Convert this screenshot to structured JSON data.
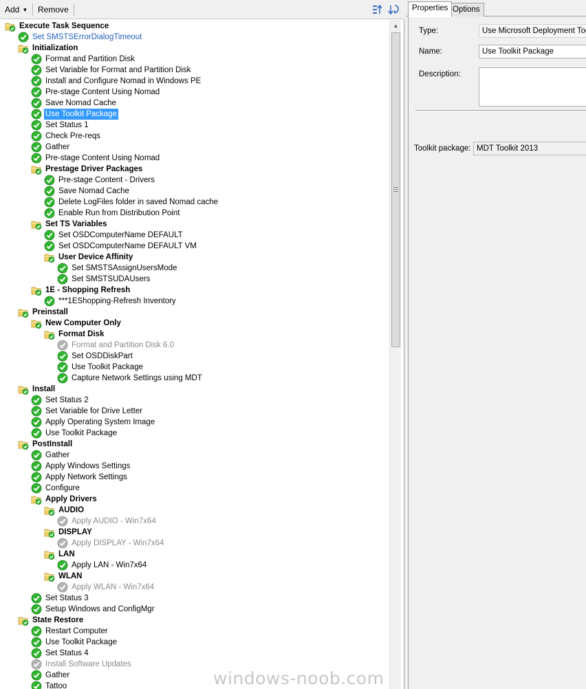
{
  "toolbar": {
    "add_label": "Add",
    "remove_label": "Remove"
  },
  "tree": [
    {
      "label": "Execute Task Sequence",
      "depth": 0,
      "kind": "group",
      "icon": "folder-check-icon"
    },
    {
      "label": "Set SMSTSErrorDialogTimeout",
      "depth": 1,
      "kind": "step",
      "icon": "green-check-icon",
      "style": "blue"
    },
    {
      "label": "Initialization",
      "depth": 1,
      "kind": "group",
      "icon": "folder-check-icon"
    },
    {
      "label": "Format and Partition Disk",
      "depth": 2,
      "kind": "step",
      "icon": "green-check-icon"
    },
    {
      "label": "Set Variable for Format and Partition Disk",
      "depth": 2,
      "kind": "step",
      "icon": "green-check-icon"
    },
    {
      "label": "Install and Configure Nomad in Windows PE",
      "depth": 2,
      "kind": "step",
      "icon": "green-check-icon"
    },
    {
      "label": "Pre-stage Content Using Nomad",
      "depth": 2,
      "kind": "step",
      "icon": "green-check-icon"
    },
    {
      "label": "Save Nomad Cache",
      "depth": 2,
      "kind": "step",
      "icon": "green-check-icon"
    },
    {
      "label": "Use Toolkit Package",
      "depth": 2,
      "kind": "step",
      "icon": "green-check-icon",
      "selected": true
    },
    {
      "label": "Set Status 1",
      "depth": 2,
      "kind": "step",
      "icon": "green-check-icon"
    },
    {
      "label": "Check Pre-reqs",
      "depth": 2,
      "kind": "step",
      "icon": "green-check-icon"
    },
    {
      "label": "Gather",
      "depth": 2,
      "kind": "step",
      "icon": "green-check-icon"
    },
    {
      "label": "Pre-stage Content Using Nomad",
      "depth": 2,
      "kind": "step",
      "icon": "green-check-icon"
    },
    {
      "label": "Prestage Driver Packages",
      "depth": 2,
      "kind": "group",
      "icon": "folder-check-icon"
    },
    {
      "label": "Pre-stage Content - Drivers",
      "depth": 3,
      "kind": "step",
      "icon": "green-check-icon"
    },
    {
      "label": "Save Nomad Cache",
      "depth": 3,
      "kind": "step",
      "icon": "green-check-icon"
    },
    {
      "label": "Delete LogFiles folder in saved Nomad cache",
      "depth": 3,
      "kind": "step",
      "icon": "green-check-icon"
    },
    {
      "label": "Enable Run from Distribution Point",
      "depth": 3,
      "kind": "step",
      "icon": "green-check-icon"
    },
    {
      "label": "Set TS Variables",
      "depth": 2,
      "kind": "group",
      "icon": "folder-check-icon"
    },
    {
      "label": "Set OSDComputerName DEFAULT",
      "depth": 3,
      "kind": "step",
      "icon": "green-check-icon"
    },
    {
      "label": "Set OSDComputerName DEFAULT VM",
      "depth": 3,
      "kind": "step",
      "icon": "green-check-icon"
    },
    {
      "label": "User Device Affinity",
      "depth": 3,
      "kind": "group",
      "icon": "folder-check-icon"
    },
    {
      "label": "Set SMSTSAssignUsersMode",
      "depth": 4,
      "kind": "step",
      "icon": "green-check-icon"
    },
    {
      "label": "Set SMSTSUDAUsers",
      "depth": 4,
      "kind": "step",
      "icon": "green-check-icon"
    },
    {
      "label": "1E - Shopping Refresh",
      "depth": 2,
      "kind": "group",
      "icon": "folder-check-icon"
    },
    {
      "label": "***1EShopping-Refresh Inventory",
      "depth": 3,
      "kind": "step",
      "icon": "green-check-icon"
    },
    {
      "label": "Preinstall",
      "depth": 1,
      "kind": "group",
      "icon": "folder-check-icon"
    },
    {
      "label": "New Computer Only",
      "depth": 2,
      "kind": "group",
      "icon": "folder-check-icon"
    },
    {
      "label": "Format Disk",
      "depth": 3,
      "kind": "group",
      "icon": "folder-check-icon"
    },
    {
      "label": "Format and Partition Disk 6.0",
      "depth": 4,
      "kind": "step",
      "icon": "grey-check-icon",
      "style": "disabled"
    },
    {
      "label": "Set OSDDiskPart",
      "depth": 4,
      "kind": "step",
      "icon": "green-check-icon"
    },
    {
      "label": "Use Toolkit Package",
      "depth": 4,
      "kind": "step",
      "icon": "green-check-icon"
    },
    {
      "label": "Capture Network Settings using MDT",
      "depth": 4,
      "kind": "step",
      "icon": "green-check-icon"
    },
    {
      "label": "Install",
      "depth": 1,
      "kind": "group",
      "icon": "folder-check-icon"
    },
    {
      "label": "Set Status 2",
      "depth": 2,
      "kind": "step",
      "icon": "green-check-icon"
    },
    {
      "label": "Set Variable for Drive Letter",
      "depth": 2,
      "kind": "step",
      "icon": "green-check-icon"
    },
    {
      "label": "Apply Operating System Image",
      "depth": 2,
      "kind": "step",
      "icon": "green-check-icon"
    },
    {
      "label": "Use Toolkit Package",
      "depth": 2,
      "kind": "step",
      "icon": "green-check-icon"
    },
    {
      "label": "PostInstall",
      "depth": 1,
      "kind": "group",
      "icon": "folder-check-icon"
    },
    {
      "label": "Gather",
      "depth": 2,
      "kind": "step",
      "icon": "green-check-icon"
    },
    {
      "label": "Apply Windows Settings",
      "depth": 2,
      "kind": "step",
      "icon": "green-check-icon"
    },
    {
      "label": "Apply Network Settings",
      "depth": 2,
      "kind": "step",
      "icon": "green-check-icon"
    },
    {
      "label": "Configure",
      "depth": 2,
      "kind": "step",
      "icon": "green-check-icon"
    },
    {
      "label": "Apply Drivers",
      "depth": 2,
      "kind": "group",
      "icon": "folder-check-icon"
    },
    {
      "label": "AUDIO",
      "depth": 3,
      "kind": "group",
      "icon": "folder-check-icon"
    },
    {
      "label": "Apply AUDIO - Win7x64",
      "depth": 4,
      "kind": "step",
      "icon": "grey-check-icon",
      "style": "disabled"
    },
    {
      "label": "DISPLAY",
      "depth": 3,
      "kind": "group",
      "icon": "folder-check-icon"
    },
    {
      "label": "Apply DISPLAY - Win7x64",
      "depth": 4,
      "kind": "step",
      "icon": "grey-check-icon",
      "style": "disabled"
    },
    {
      "label": "LAN",
      "depth": 3,
      "kind": "group",
      "icon": "folder-check-icon"
    },
    {
      "label": "Apply LAN - Win7x64",
      "depth": 4,
      "kind": "step",
      "icon": "green-check-icon"
    },
    {
      "label": "WLAN",
      "depth": 3,
      "kind": "group",
      "icon": "folder-check-icon"
    },
    {
      "label": "Apply WLAN - Win7x64",
      "depth": 4,
      "kind": "step",
      "icon": "grey-check-icon",
      "style": "disabled"
    },
    {
      "label": "Set Status 3",
      "depth": 2,
      "kind": "step",
      "icon": "green-check-icon"
    },
    {
      "label": "Setup Windows and ConfigMgr",
      "depth": 2,
      "kind": "step",
      "icon": "green-check-icon"
    },
    {
      "label": "State Restore",
      "depth": 1,
      "kind": "group",
      "icon": "folder-check-icon"
    },
    {
      "label": "Restart Computer",
      "depth": 2,
      "kind": "step",
      "icon": "green-check-icon"
    },
    {
      "label": "Use Toolkit Package",
      "depth": 2,
      "kind": "step",
      "icon": "green-check-icon"
    },
    {
      "label": "Set Status 4",
      "depth": 2,
      "kind": "step",
      "icon": "green-check-icon"
    },
    {
      "label": "Install Software Updates",
      "depth": 2,
      "kind": "step",
      "icon": "grey-check-icon",
      "style": "disabled"
    },
    {
      "label": "Gather",
      "depth": 2,
      "kind": "step",
      "icon": "green-check-icon"
    },
    {
      "label": "Tattoo",
      "depth": 2,
      "kind": "step",
      "icon": "green-check-icon"
    }
  ],
  "tabs": {
    "properties": "Properties",
    "options": "Options"
  },
  "properties": {
    "type_label": "Type:",
    "type_value": "Use Microsoft Deployment Toolkit Package",
    "name_label": "Name:",
    "name_value": "Use Toolkit Package",
    "description_label": "Description:",
    "description_value": "",
    "toolkit_label": "Toolkit package:",
    "toolkit_value": "MDT Toolkit 2013"
  },
  "watermark": "windows-noob.com",
  "colors": {
    "selection": "#3399ff",
    "check_green": "#2fb52f",
    "check_grey": "#b4b4b4",
    "folder_yellow": "#f2d26a",
    "link_blue": "#1f5fbf"
  }
}
